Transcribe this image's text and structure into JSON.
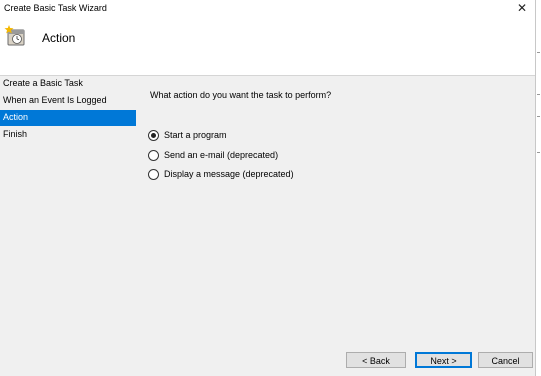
{
  "window": {
    "title": "Create Basic Task Wizard",
    "close_label": "✕"
  },
  "header": {
    "title": "Action",
    "icon": "task-scheduler-icon"
  },
  "sidebar": {
    "items": [
      {
        "label": "Create a Basic Task",
        "active": false
      },
      {
        "label": "When an Event Is Logged",
        "active": false
      },
      {
        "label": "Action",
        "active": true
      },
      {
        "label": "Finish",
        "active": false
      }
    ]
  },
  "main": {
    "question": "What action do you want the task to perform?",
    "options": [
      {
        "label": "Start a program",
        "selected": true
      },
      {
        "label": "Send an e-mail (deprecated)",
        "selected": false
      },
      {
        "label": "Display a message (deprecated)",
        "selected": false
      }
    ]
  },
  "footer": {
    "back_label": "< Back",
    "next_label": "Next >",
    "cancel_label": "Cancel"
  },
  "colors": {
    "selection": "#0078d7",
    "window_bg": "#f0f0f0"
  }
}
